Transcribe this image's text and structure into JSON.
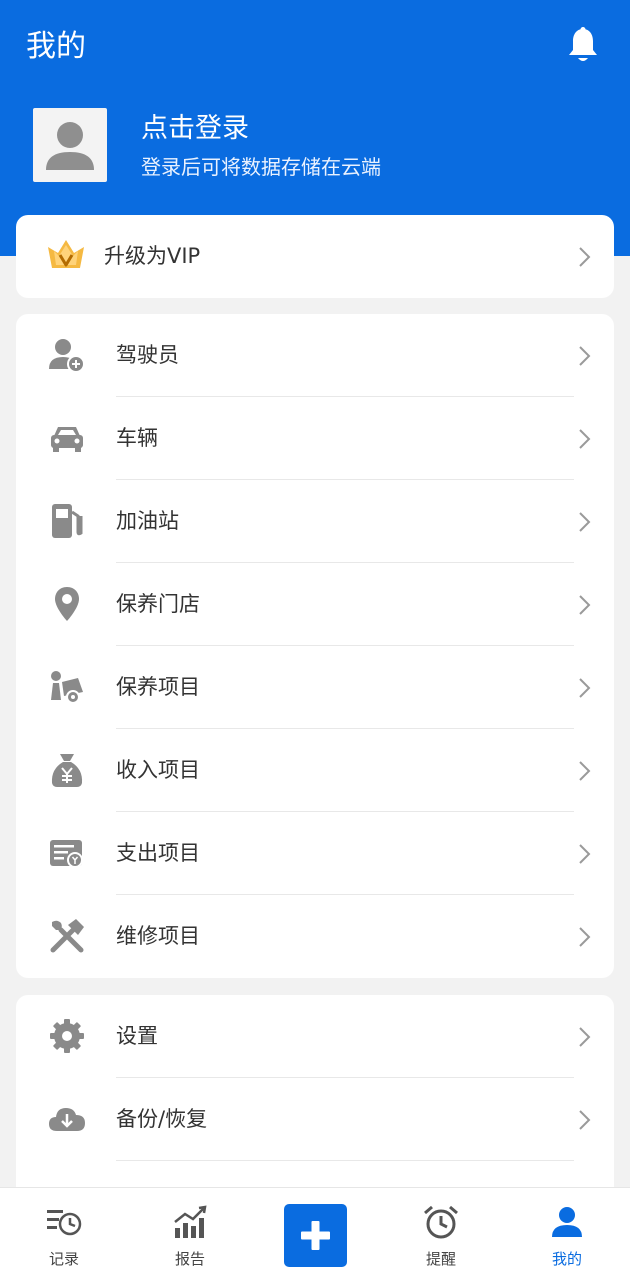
{
  "header": {
    "title": "我的",
    "bell_icon": "bell-icon"
  },
  "profile": {
    "login_title": "点击登录",
    "login_subtitle": "登录后可将数据存储在云端",
    "avatar_icon": "person-avatar-icon"
  },
  "vip": {
    "label": "升级为VIP",
    "icon": "vip-crown-icon"
  },
  "menu1": [
    {
      "label": "驾驶员",
      "icon": "driver-add-icon"
    },
    {
      "label": "车辆",
      "icon": "car-icon"
    },
    {
      "label": "加油站",
      "icon": "gas-station-icon"
    },
    {
      "label": "保养门店",
      "icon": "location-pin-icon"
    },
    {
      "label": "保养项目",
      "icon": "maintenance-icon"
    },
    {
      "label": "收入项目",
      "icon": "money-bag-icon"
    },
    {
      "label": "支出项目",
      "icon": "bill-icon"
    },
    {
      "label": "维修项目",
      "icon": "tools-icon"
    }
  ],
  "menu2": [
    {
      "label": "设置",
      "icon": "gear-icon"
    },
    {
      "label": "备份/恢复",
      "icon": "cloud-download-icon"
    }
  ],
  "tabbar": [
    {
      "label": "记录",
      "icon": "record-icon"
    },
    {
      "label": "报告",
      "icon": "report-chart-icon"
    },
    {
      "label": "提醒",
      "icon": "alarm-clock-icon"
    },
    {
      "label": "我的",
      "icon": "person-icon"
    }
  ],
  "colors": {
    "primary": "#0a6ce0",
    "icon_gray": "#8a8a8a",
    "vip_gold": "#f5b942",
    "background": "#f2f2f2"
  }
}
